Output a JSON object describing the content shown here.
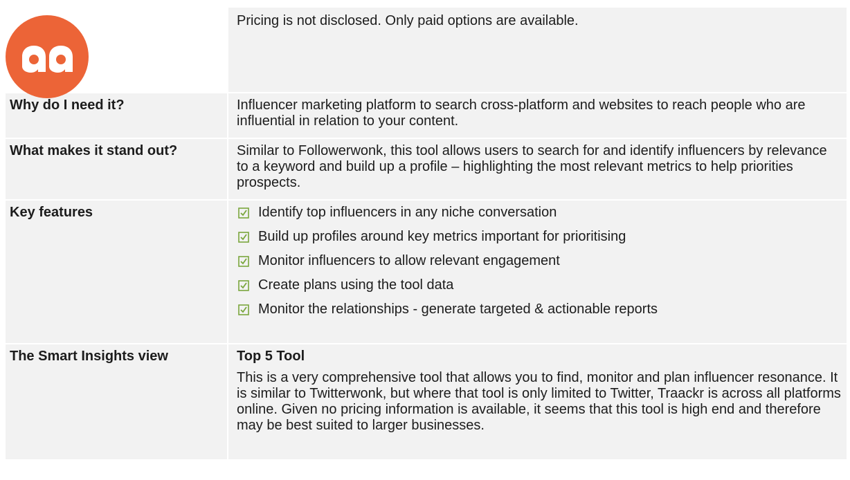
{
  "logo": {
    "text": "aa",
    "color": "#ec6437"
  },
  "rows": {
    "pricing": {
      "value": "Pricing is not disclosed. Only paid options are available."
    },
    "why": {
      "label": "Why do I need it?",
      "value": "Influencer marketing platform to search cross-platform and websites to reach people who are influential in relation to your content."
    },
    "stand_out": {
      "label": "What makes it stand out?",
      "value": "Similar to Followerwonk, this tool allows users to search for and identify influencers by relevance to a keyword and build up a profile – highlighting the most relevant metrics to help priorities prospects."
    },
    "features": {
      "label": "Key features",
      "items": [
        "Identify top influencers in any niche conversation",
        "Build up profiles around key metrics important for prioritising",
        "Monitor influencers to allow relevant engagement",
        "Create plans using the tool data",
        "Monitor the relationships - generate targeted & actionable reports"
      ],
      "check_color": "#7aa63d"
    },
    "view": {
      "label": "The Smart Insights view",
      "title": "Top 5 Tool",
      "value": "This is a very comprehensive tool that allows you to find, monitor and plan influencer resonance. It is similar to Twitterwonk, but where that tool is only limited to Twitter, Traackr is across all platforms online. Given no pricing information is available, it seems that this tool is high end and therefore may be best suited to larger businesses."
    }
  }
}
